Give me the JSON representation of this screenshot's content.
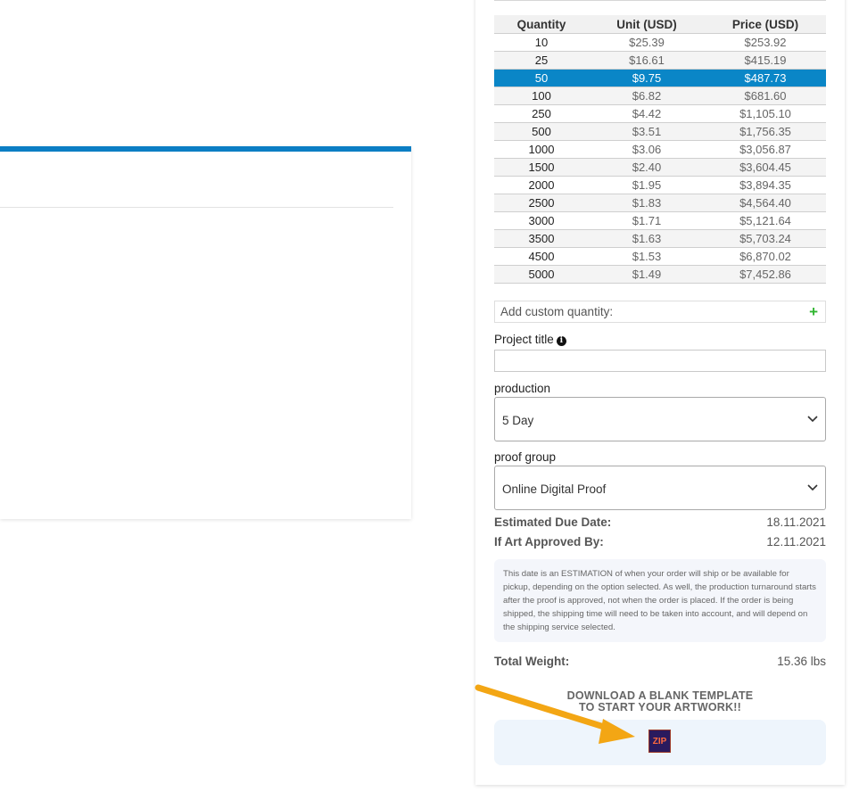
{
  "pricing_table": {
    "headers": [
      "Quantity",
      "Unit (USD)",
      "Price (USD)"
    ],
    "selected_quantity": "50",
    "rows": [
      [
        "10",
        "$25.39",
        "$253.92"
      ],
      [
        "25",
        "$16.61",
        "$415.19"
      ],
      [
        "50",
        "$9.75",
        "$487.73"
      ],
      [
        "100",
        "$6.82",
        "$681.60"
      ],
      [
        "250",
        "$4.42",
        "$1,105.10"
      ],
      [
        "500",
        "$3.51",
        "$1,756.35"
      ],
      [
        "1000",
        "$3.06",
        "$3,056.87"
      ],
      [
        "1500",
        "$2.40",
        "$3,604.45"
      ],
      [
        "2000",
        "$1.95",
        "$3,894.35"
      ],
      [
        "2500",
        "$1.83",
        "$4,564.40"
      ],
      [
        "3000",
        "$1.71",
        "$5,121.64"
      ],
      [
        "3500",
        "$1.63",
        "$5,703.24"
      ],
      [
        "4500",
        "$1.53",
        "$6,870.02"
      ],
      [
        "5000",
        "$1.49",
        "$7,452.86"
      ]
    ]
  },
  "custom_quantity": {
    "label": "Add custom quantity:",
    "add_icon": "plus-icon"
  },
  "project_title": {
    "label": "Project title",
    "info_icon": "info-icon",
    "value": ""
  },
  "production": {
    "label": "production",
    "selected": "5 Day"
  },
  "proof_group": {
    "label": "proof group",
    "selected": "Online Digital Proof"
  },
  "estimated_due_date": {
    "label": "Estimated Due Date:",
    "value": "18.11.2021"
  },
  "art_approved_by": {
    "label": "If Art Approved By:",
    "value": "12.11.2021"
  },
  "estimation_note": "This date is an ESTIMATION of when your order will ship or be available for pickup, depending on the option selected. As well, the production turnaround starts after the proof is approved, not when the order is placed. If the order is being shipped, the shipping time will need to be taken into account, and will depend on the shipping service selected.",
  "total_weight": {
    "label": "Total Weight:",
    "value": "15.36 lbs"
  },
  "template": {
    "line1": "DOWNLOAD A BLANK TEMPLATE",
    "line2": "TO START YOUR ARTWORK!!",
    "zip_label": "ZIP"
  },
  "colors": {
    "accent": "#0b7ec4",
    "selected_row": "#0a86c7",
    "add_green": "#2fb52f",
    "annotation_arrow": "#f3a614"
  }
}
